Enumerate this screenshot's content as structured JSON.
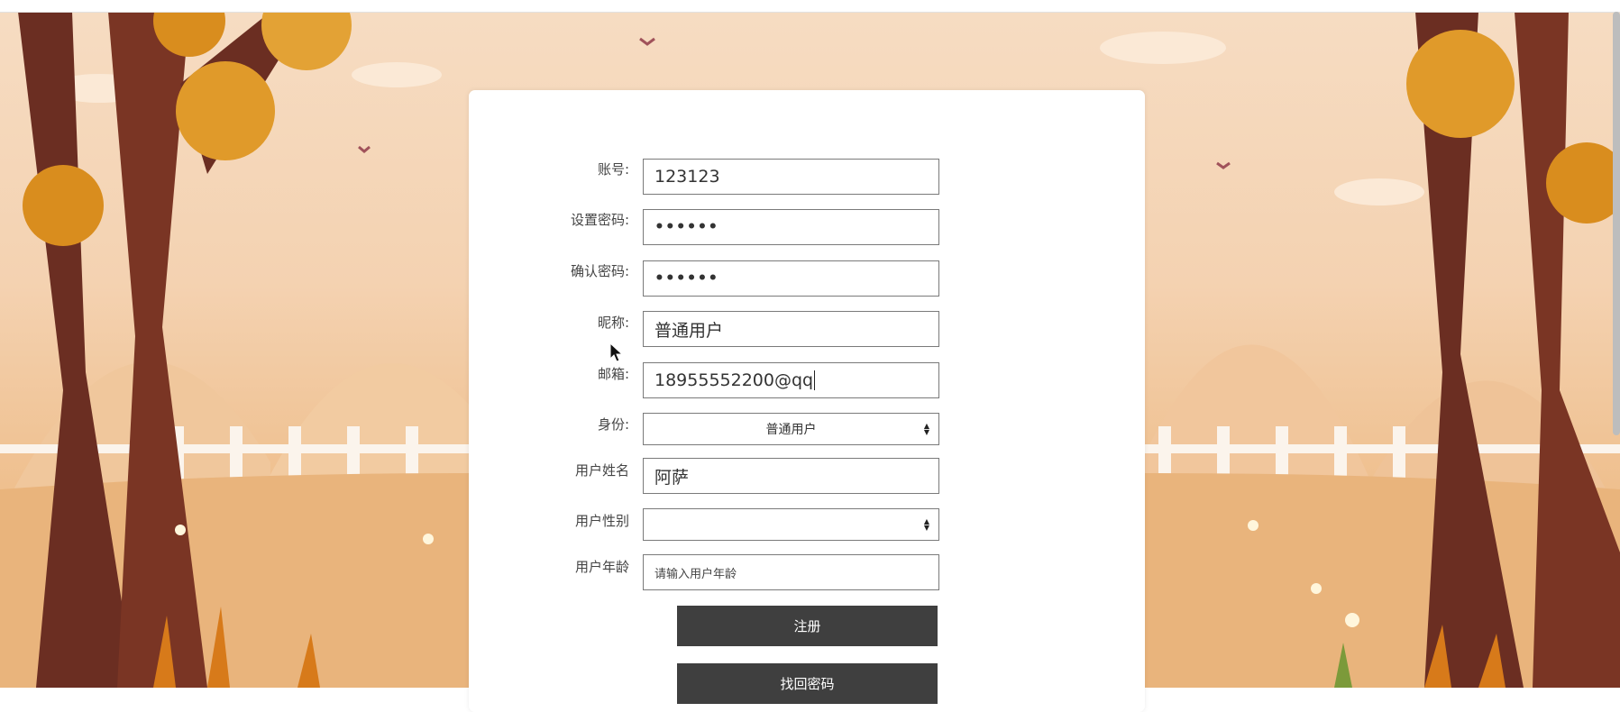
{
  "form": {
    "account_label": "账号:",
    "account_value": "123123",
    "password_label": "设置密码:",
    "password_value": "••••••",
    "confirm_label": "确认密码:",
    "confirm_value": "••••••",
    "nickname_label": "昵称:",
    "nickname_value": "普通用户",
    "email_label": "邮箱:",
    "email_value": "18955552200@qq",
    "role_label": "身份:",
    "role_value": "普通用户",
    "realname_label": "用户姓名",
    "realname_value": "阿萨",
    "gender_label": "用户性别",
    "gender_value": "",
    "age_label": "用户年龄",
    "age_placeholder": "请输入用户年龄",
    "register_button": "注册",
    "recover_button": "找回密码"
  },
  "icons": {
    "select_arrow": "select-arrows-icon",
    "mouse_pointer": "mouse-pointer-icon"
  },
  "colors": {
    "button_bg": "#3f3f3f",
    "card_bg": "#ffffff",
    "field_border": "#7a7a7a"
  }
}
